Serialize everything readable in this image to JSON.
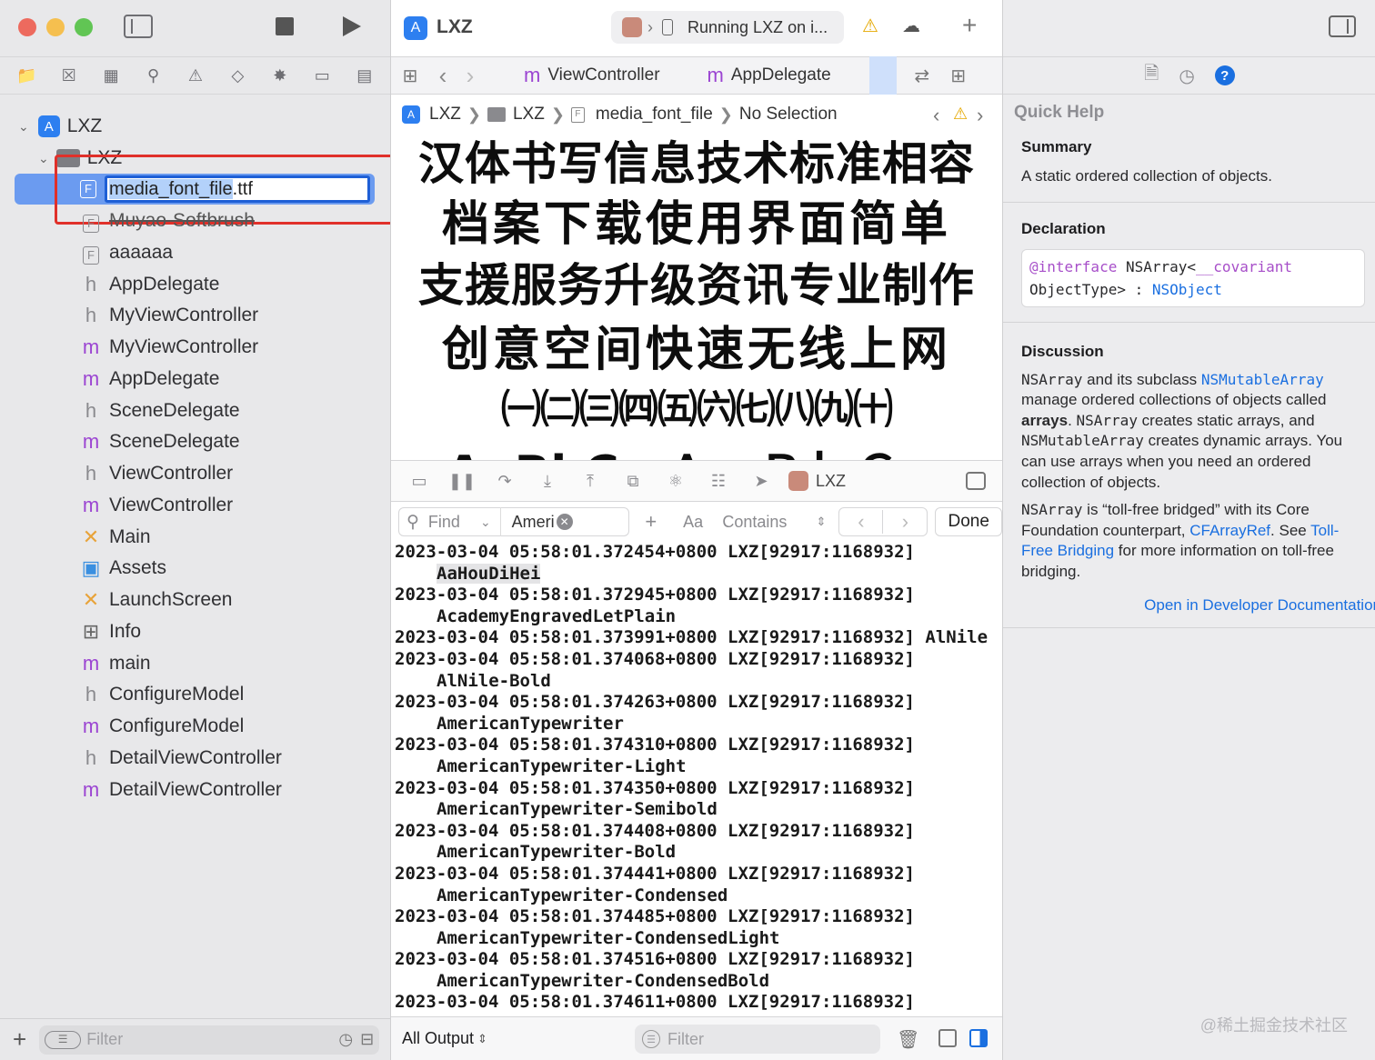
{
  "project": "LXZ",
  "left": {
    "rename_value_selected": "media_font_file",
    "rename_value_ext": ".ttf",
    "group_name": "LXZ",
    "files": [
      {
        "type": "F",
        "name": "Muyao-Softbrush"
      },
      {
        "type": "F",
        "name": "aaaaaa"
      },
      {
        "type": "h",
        "name": "AppDelegate"
      },
      {
        "type": "h",
        "name": "MyViewController"
      },
      {
        "type": "m",
        "name": "MyViewController"
      },
      {
        "type": "m",
        "name": "AppDelegate"
      },
      {
        "type": "h",
        "name": "SceneDelegate"
      },
      {
        "type": "m",
        "name": "SceneDelegate"
      },
      {
        "type": "h",
        "name": "ViewController"
      },
      {
        "type": "m",
        "name": "ViewController"
      },
      {
        "type": "x",
        "name": "Main"
      },
      {
        "type": "a",
        "name": "Assets"
      },
      {
        "type": "x",
        "name": "LaunchScreen"
      },
      {
        "type": "t",
        "name": "Info"
      },
      {
        "type": "m",
        "name": "main"
      },
      {
        "type": "h",
        "name": "ConfigureModel"
      },
      {
        "type": "m",
        "name": "ConfigureModel"
      },
      {
        "type": "h",
        "name": "DetailViewController"
      },
      {
        "type": "m",
        "name": "DetailViewController"
      }
    ],
    "filter_placeholder": "Filter",
    "add_label": "+"
  },
  "center": {
    "scheme_status": "Running LXZ on i...",
    "tabs": [
      {
        "prefix": "m",
        "label": "ViewController"
      },
      {
        "prefix": "m",
        "label": "AppDelegate"
      }
    ],
    "jump": {
      "a": "LXZ",
      "b": "LXZ",
      "c": "media_font_file",
      "d": "No Selection"
    },
    "preview_lines": [
      "汉体书写信息技术标准相容",
      "档案下载使用界面简单",
      "支援服务升级资讯专业制作",
      "创意空间快速无线上网",
      "㈠㈡㈢㈣㈤㈥㈦㈧㈨㈩",
      "AaBbCc ＡａＢｂＣｃ"
    ],
    "debug_target": "LXZ",
    "find": {
      "mode": "Find",
      "query": "Ameri",
      "case": "Aa",
      "match": "Contains",
      "done": "Done"
    },
    "console": [
      {
        "indent": false,
        "text": "2023-03-04 05:58:01.372454+0800 LXZ[92917:1168932]"
      },
      {
        "indent": true,
        "text": "AaHouDiHei",
        "highlight": true
      },
      {
        "indent": false,
        "text": "2023-03-04 05:58:01.372945+0800 LXZ[92917:1168932]"
      },
      {
        "indent": true,
        "text": "AcademyEngravedLetPlain"
      },
      {
        "indent": false,
        "text": "2023-03-04 05:58:01.373991+0800 LXZ[92917:1168932] AlNile"
      },
      {
        "indent": false,
        "text": "2023-03-04 05:58:01.374068+0800 LXZ[92917:1168932]"
      },
      {
        "indent": true,
        "text": "AlNile-Bold"
      },
      {
        "indent": false,
        "text": "2023-03-04 05:58:01.374263+0800 LXZ[92917:1168932]"
      },
      {
        "indent": true,
        "text": "AmericanTypewriter"
      },
      {
        "indent": false,
        "text": "2023-03-04 05:58:01.374310+0800 LXZ[92917:1168932]"
      },
      {
        "indent": true,
        "text": "AmericanTypewriter-Light"
      },
      {
        "indent": false,
        "text": "2023-03-04 05:58:01.374350+0800 LXZ[92917:1168932]"
      },
      {
        "indent": true,
        "text": "AmericanTypewriter-Semibold"
      },
      {
        "indent": false,
        "text": "2023-03-04 05:58:01.374408+0800 LXZ[92917:1168932]"
      },
      {
        "indent": true,
        "text": "AmericanTypewriter-Bold"
      },
      {
        "indent": false,
        "text": "2023-03-04 05:58:01.374441+0800 LXZ[92917:1168932]"
      },
      {
        "indent": true,
        "text": "AmericanTypewriter-Condensed"
      },
      {
        "indent": false,
        "text": "2023-03-04 05:58:01.374485+0800 LXZ[92917:1168932]"
      },
      {
        "indent": true,
        "text": "AmericanTypewriter-CondensedLight"
      },
      {
        "indent": false,
        "text": "2023-03-04 05:58:01.374516+0800 LXZ[92917:1168932]"
      },
      {
        "indent": true,
        "text": "AmericanTypewriter-CondensedBold"
      },
      {
        "indent": false,
        "text": "2023-03-04 05:58:01.374611+0800 LXZ[92917:1168932]"
      }
    ],
    "output_selector": "All Output",
    "filter_placeholder": "Filter"
  },
  "right": {
    "title": "Quick Help",
    "summary_h": "Summary",
    "summary": "A static ordered collection of objects.",
    "declaration_h": "Declaration",
    "decl_kw1": "@interface",
    "decl_t1": " NSArray<",
    "decl_kw2": "__covariant",
    "decl_t2": "ObjectType> : ",
    "decl_link": "NSObject",
    "discussion_h": "Discussion",
    "d1a": "NSArray",
    "d1b": " and its subclass ",
    "d1link": "NSMutableArray",
    "d1c": " manage ordered collections of objects called ",
    "d1bold": "arrays",
    "d1d": ". ",
    "d1e": "NSArray",
    "d1f": " creates static arrays, and ",
    "d1g": "NSMutableArray",
    "d1h": " creates dynamic arrays. You can use arrays when you need an ordered collection of objects.",
    "d2a": "NSArray",
    "d2b": " is “toll-free bridged” with its Core Foundation counterpart, ",
    "d2link1": "CFArrayRef",
    "d2c": ". See ",
    "d2link2": "Toll-Free Bridging",
    "d2d": " for more information on toll-free bridging.",
    "open_docs": "Open in Developer Documentation",
    "watermark": "@稀土掘金技术社区"
  },
  "colors": {
    "accent": "#1a6fe0",
    "selection": "#6b9bf0",
    "annotation": "#e0302a",
    "m_file": "#9b44d2"
  }
}
